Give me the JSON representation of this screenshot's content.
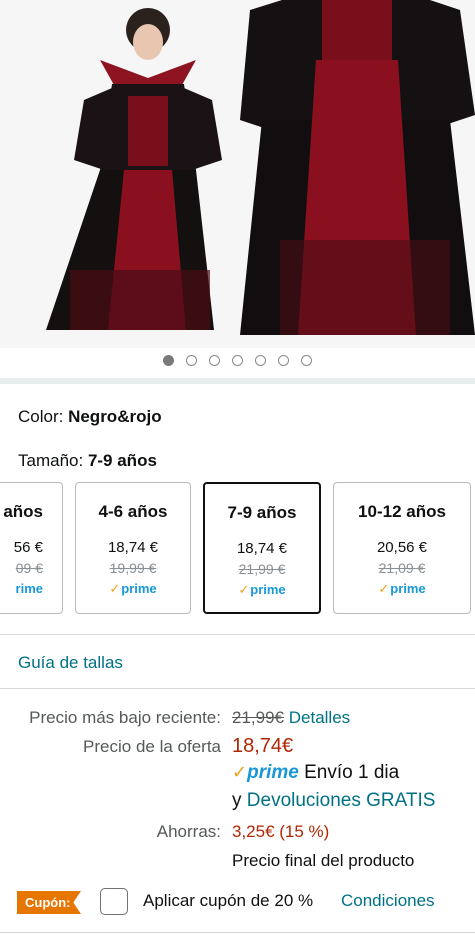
{
  "gallery": {
    "image_count": 7,
    "active_index": 0
  },
  "color": {
    "label": "Color: ",
    "value": "Negro&rojo"
  },
  "size": {
    "label": "Tamaño: ",
    "value": "7-9 años"
  },
  "size_options": [
    {
      "size": "años",
      "price": "56 €",
      "old_price": "09 €",
      "prime": "rime"
    },
    {
      "size": "4-6 años",
      "price": "18,74 €",
      "old_price": "19,99 €",
      "prime": "prime"
    },
    {
      "size": "7-9 años",
      "price": "18,74 €",
      "old_price": "21,99 €",
      "prime": "prime"
    },
    {
      "size": "10-12 años",
      "price": "20,56 €",
      "old_price": "21,09 €",
      "prime": "prime"
    }
  ],
  "size_guide": "Guía de tallas",
  "pricing": {
    "lowest_label": "Precio más bajo reciente:",
    "lowest_value": "21,99€",
    "details_link": "Detalles",
    "offer_label": "Precio de la oferta",
    "offer_value": "18,74€",
    "prime_word": "prime",
    "shipping": "Envío 1 dia",
    "returns_prefix": "y",
    "returns_link": "Devoluciones GRATIS",
    "savings_label": "Ahorras:",
    "savings_value": "3,25€ (15 %)",
    "final_note": "Precio final del producto"
  },
  "coupon": {
    "badge": "Cupón:",
    "text": "Aplicar cupón de 20 %",
    "link": "Condiciones"
  },
  "colors": {
    "link": "#007185",
    "price_red": "#b12704",
    "prime_blue": "#1a98d6",
    "coupon_orange": "#e77600"
  }
}
